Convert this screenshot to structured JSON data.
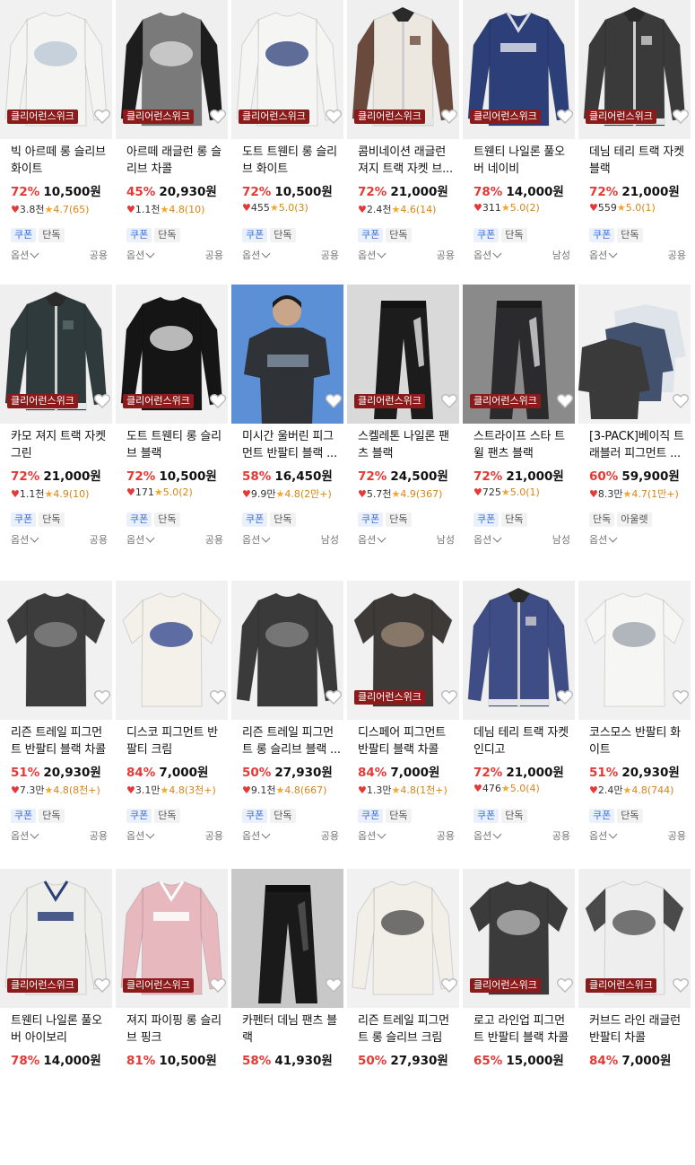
{
  "badge_text": "클리어런스위크",
  "option_label": "옵션",
  "products": [
    {
      "title": "빅 아르떼 롱 슬리브 화이트",
      "discount": "72%",
      "price": "10,500원",
      "likes": "3.8천",
      "rating": "4.7(65)",
      "tags": [
        "쿠폰",
        "단독"
      ],
      "gender": "공용",
      "badge": true,
      "img": {
        "bg": "#f1f1f1",
        "body": "#f4f4f2",
        "sleeve": "#f4f4f2",
        "print": "#b8c6d4",
        "kind": "longsleeve"
      }
    },
    {
      "title": "아르떼 래글런 롱 슬리브 차콜",
      "discount": "45%",
      "price": "20,930원",
      "likes": "1.1천",
      "rating": "4.8(10)",
      "tags": [
        "쿠폰",
        "단독"
      ],
      "gender": "공용",
      "badge": true,
      "img": {
        "bg": "#efefef",
        "body": "#7a7a7a",
        "sleeve": "#1d1d1d",
        "print": "#e0e0e0",
        "kind": "longsleeve"
      }
    },
    {
      "title": "도트 트웬티 롱 슬리브 화이트",
      "discount": "72%",
      "price": "10,500원",
      "likes": "455",
      "rating": "5.0(3)",
      "tags": [
        "쿠폰",
        "단독"
      ],
      "gender": "공용",
      "badge": true,
      "img": {
        "bg": "#f1f1f1",
        "body": "#f5f5f3",
        "sleeve": "#f5f5f3",
        "print": "#2b3f7a",
        "kind": "longsleeve"
      }
    },
    {
      "title": "콤비네이션 래글런 져지 트랙 자켓 브...",
      "discount": "72%",
      "price": "21,000원",
      "likes": "2.4천",
      "rating": "4.6(14)",
      "tags": [
        "쿠폰",
        "단독"
      ],
      "gender": "공용",
      "badge": true,
      "img": {
        "bg": "#efefef",
        "body": "#ece8df",
        "sleeve": "#6b4a3e",
        "print": "#6b4a3e",
        "kind": "jacket"
      }
    },
    {
      "title": "트웬티 나일론 풀오버 네이비",
      "discount": "78%",
      "price": "14,000원",
      "likes": "311",
      "rating": "5.0(2)",
      "tags": [
        "쿠폰",
        "단독"
      ],
      "gender": "남성",
      "badge": true,
      "img": {
        "bg": "#efefef",
        "body": "#2d3f78",
        "sleeve": "#2d3f78",
        "print": "#d8dbe6",
        "kind": "jersey"
      }
    },
    {
      "title": "데님 테리 트랙 자켓 블랙",
      "discount": "72%",
      "price": "21,000원",
      "likes": "559",
      "rating": "5.0(1)",
      "tags": [
        "쿠폰",
        "단독"
      ],
      "gender": "공용",
      "badge": true,
      "img": {
        "bg": "#efefef",
        "body": "#3a3a3a",
        "sleeve": "#3a3a3a",
        "print": "#d0d0d0",
        "kind": "jacket"
      }
    },
    {
      "title": "카모 져지 트랙 자켓 그린",
      "discount": "72%",
      "price": "21,000원",
      "likes": "1.1천",
      "rating": "4.9(10)",
      "tags": [
        "쿠폰",
        "단독"
      ],
      "gender": "공용",
      "badge": true,
      "img": {
        "bg": "#efefef",
        "body": "#2e3a3c",
        "sleeve": "#2e3a3c",
        "print": "#5a6a6c",
        "kind": "jacket"
      }
    },
    {
      "title": "도트 트웬티 롱 슬리브 블랙",
      "discount": "72%",
      "price": "10,500원",
      "likes": "171",
      "rating": "5.0(2)",
      "tags": [
        "쿠폰",
        "단독"
      ],
      "gender": "공용",
      "badge": true,
      "img": {
        "bg": "#f1f1f1",
        "body": "#151515",
        "sleeve": "#151515",
        "print": "#f0f0f0",
        "kind": "longsleeve"
      }
    },
    {
      "title": "미시간 울버린 피그먼트 반팔티 블랙 ...",
      "discount": "58%",
      "price": "16,450원",
      "likes": "9.9만",
      "rating": "4.8(2만+)",
      "tags": [
        "쿠폰",
        "단독"
      ],
      "gender": "남성",
      "badge": false,
      "img": {
        "bg": "#5b8fd6",
        "body": "#2f3236",
        "sleeve": "#2f3236",
        "print": "#8fa0b4",
        "kind": "model"
      }
    },
    {
      "title": "스켈레톤 나일론 팬츠 블랙",
      "discount": "72%",
      "price": "24,500원",
      "likes": "5.7천",
      "rating": "4.9(367)",
      "tags": [
        "쿠폰",
        "단독"
      ],
      "gender": "남성",
      "badge": true,
      "img": {
        "bg": "#d9d9d9",
        "body": "#1c1c1c",
        "sleeve": "#1c1c1c",
        "print": "#e8e8e8",
        "kind": "pants"
      }
    },
    {
      "title": "스트라이프 스타 트윌 팬츠 블랙",
      "discount": "72%",
      "price": "21,000원",
      "likes": "725",
      "rating": "5.0(1)",
      "tags": [
        "쿠폰",
        "단독"
      ],
      "gender": "남성",
      "badge": true,
      "img": {
        "bg": "#8a8a8a",
        "body": "#2b2b2d",
        "sleeve": "#2b2b2d",
        "print": "#d8d8d8",
        "kind": "pants"
      }
    },
    {
      "title": "[3-PACK]베이직 트래블러 피그먼트 ...",
      "discount": "60%",
      "price": "59,900원",
      "likes": "8.3만",
      "rating": "4.7(1만+)",
      "tags": [
        "단독",
        "아울렛"
      ],
      "gender": "",
      "badge": false,
      "img": {
        "bg": "#f1f1f1",
        "body": "#3a3a3a",
        "sleeve": "#3a3a3a",
        "print": "#42526e",
        "kind": "pack"
      }
    },
    {
      "title": "리즌 트레일 피그먼트 반팔티 블랙 차콜",
      "discount": "51%",
      "price": "20,930원",
      "likes": "7.3만",
      "rating": "4.8(8천+)",
      "tags": [
        "쿠폰",
        "단독"
      ],
      "gender": "공용",
      "badge": false,
      "img": {
        "bg": "#f1f1f1",
        "body": "#3c3c3c",
        "sleeve": "#3c3c3c",
        "print": "#8a8a8a",
        "kind": "tee"
      }
    },
    {
      "title": "디스코 피그먼트 반팔티 크림",
      "discount": "84%",
      "price": "7,000원",
      "likes": "3.1만",
      "rating": "4.8(3천+)",
      "tags": [
        "쿠폰",
        "단독"
      ],
      "gender": "공용",
      "badge": false,
      "img": {
        "bg": "#f1f1f1",
        "body": "#f4f1ea",
        "sleeve": "#f4f1ea",
        "print": "#2b3f8a",
        "kind": "tee"
      }
    },
    {
      "title": "리즌 트레일 피그먼트 롱 슬리브 블랙 ...",
      "discount": "50%",
      "price": "27,930원",
      "likes": "9.1천",
      "rating": "4.8(667)",
      "tags": [
        "쿠폰",
        "단독"
      ],
      "gender": "공용",
      "badge": false,
      "img": {
        "bg": "#f1f1f1",
        "body": "#3a3a3a",
        "sleeve": "#3a3a3a",
        "print": "#8a8a8a",
        "kind": "longsleeve"
      }
    },
    {
      "title": "디스페어 피그먼트 반팔티 블랙 차콜",
      "discount": "84%",
      "price": "7,000원",
      "likes": "1.3만",
      "rating": "4.8(1천+)",
      "tags": [
        "쿠폰",
        "단독"
      ],
      "gender": "공용",
      "badge": true,
      "img": {
        "bg": "#f1f1f1",
        "body": "#3d3a38",
        "sleeve": "#3d3a38",
        "print": "#a08c7a",
        "kind": "tee"
      }
    },
    {
      "title": "데님 테리 트랙 자켓 인디고",
      "discount": "72%",
      "price": "21,000원",
      "likes": "476",
      "rating": "5.0(4)",
      "tags": [
        "쿠폰",
        "단독"
      ],
      "gender": "공용",
      "badge": false,
      "img": {
        "bg": "#efefef",
        "body": "#3e4d86",
        "sleeve": "#3e4d86",
        "print": "#d0d0d0",
        "kind": "jacket"
      }
    },
    {
      "title": "코스모스 반팔티 화이트",
      "discount": "51%",
      "price": "20,930원",
      "likes": "2.4만",
      "rating": "4.8(744)",
      "tags": [
        "쿠폰",
        "단독"
      ],
      "gender": "공용",
      "badge": false,
      "img": {
        "bg": "#f1f1f1",
        "body": "#f6f6f4",
        "sleeve": "#f6f6f4",
        "print": "#9aa0aa",
        "kind": "tee"
      }
    },
    {
      "title": "트웬티 나일론 풀오버 아이보리",
      "discount": "78%",
      "price": "14,000원",
      "likes": "",
      "rating": "",
      "tags": [],
      "gender": "",
      "badge": true,
      "img": {
        "bg": "#efefef",
        "body": "#eeeeea",
        "sleeve": "#eeeeea",
        "print": "#2d3f78",
        "kind": "jersey"
      }
    },
    {
      "title": "져지 파이핑 롱 슬리브 핑크",
      "discount": "81%",
      "price": "10,500원",
      "likes": "",
      "rating": "",
      "tags": [],
      "gender": "",
      "badge": true,
      "img": {
        "bg": "#efefef",
        "body": "#e8b8bf",
        "sleeve": "#e8b8bf",
        "print": "#ffffff",
        "kind": "jersey"
      }
    },
    {
      "title": "카펜터 데님 팬츠 블랙",
      "discount": "58%",
      "price": "41,930원",
      "likes": "",
      "rating": "",
      "tags": [],
      "gender": "",
      "badge": false,
      "img": {
        "bg": "#c8c8c8",
        "body": "#1a1a1a",
        "sleeve": "#1a1a1a",
        "print": "#555555",
        "kind": "pants"
      }
    },
    {
      "title": "리즌 트레일 피그먼트 롱 슬리브 크림",
      "discount": "50%",
      "price": "27,930원",
      "likes": "",
      "rating": "",
      "tags": [],
      "gender": "",
      "badge": false,
      "img": {
        "bg": "#f1f1f1",
        "body": "#f2efe8",
        "sleeve": "#f2efe8",
        "print": "#444444",
        "kind": "longsleeve"
      }
    },
    {
      "title": "로고 라인업 피그먼트 반팔티 블랙 차콜",
      "discount": "65%",
      "price": "15,000원",
      "likes": "",
      "rating": "",
      "tags": [],
      "gender": "",
      "badge": true,
      "img": {
        "bg": "#efefef",
        "body": "#3b3b3b",
        "sleeve": "#3b3b3b",
        "print": "#bdbdbd",
        "kind": "tee"
      }
    },
    {
      "title": "커브드 라인 래글런 반팔티 차콜",
      "discount": "84%",
      "price": "7,000원",
      "likes": "",
      "rating": "",
      "tags": [],
      "gender": "",
      "badge": true,
      "img": {
        "bg": "#efefef",
        "body": "#eeeeee",
        "sleeve": "#4a4a4a",
        "print": "#4a4a4a",
        "kind": "tee"
      }
    }
  ]
}
